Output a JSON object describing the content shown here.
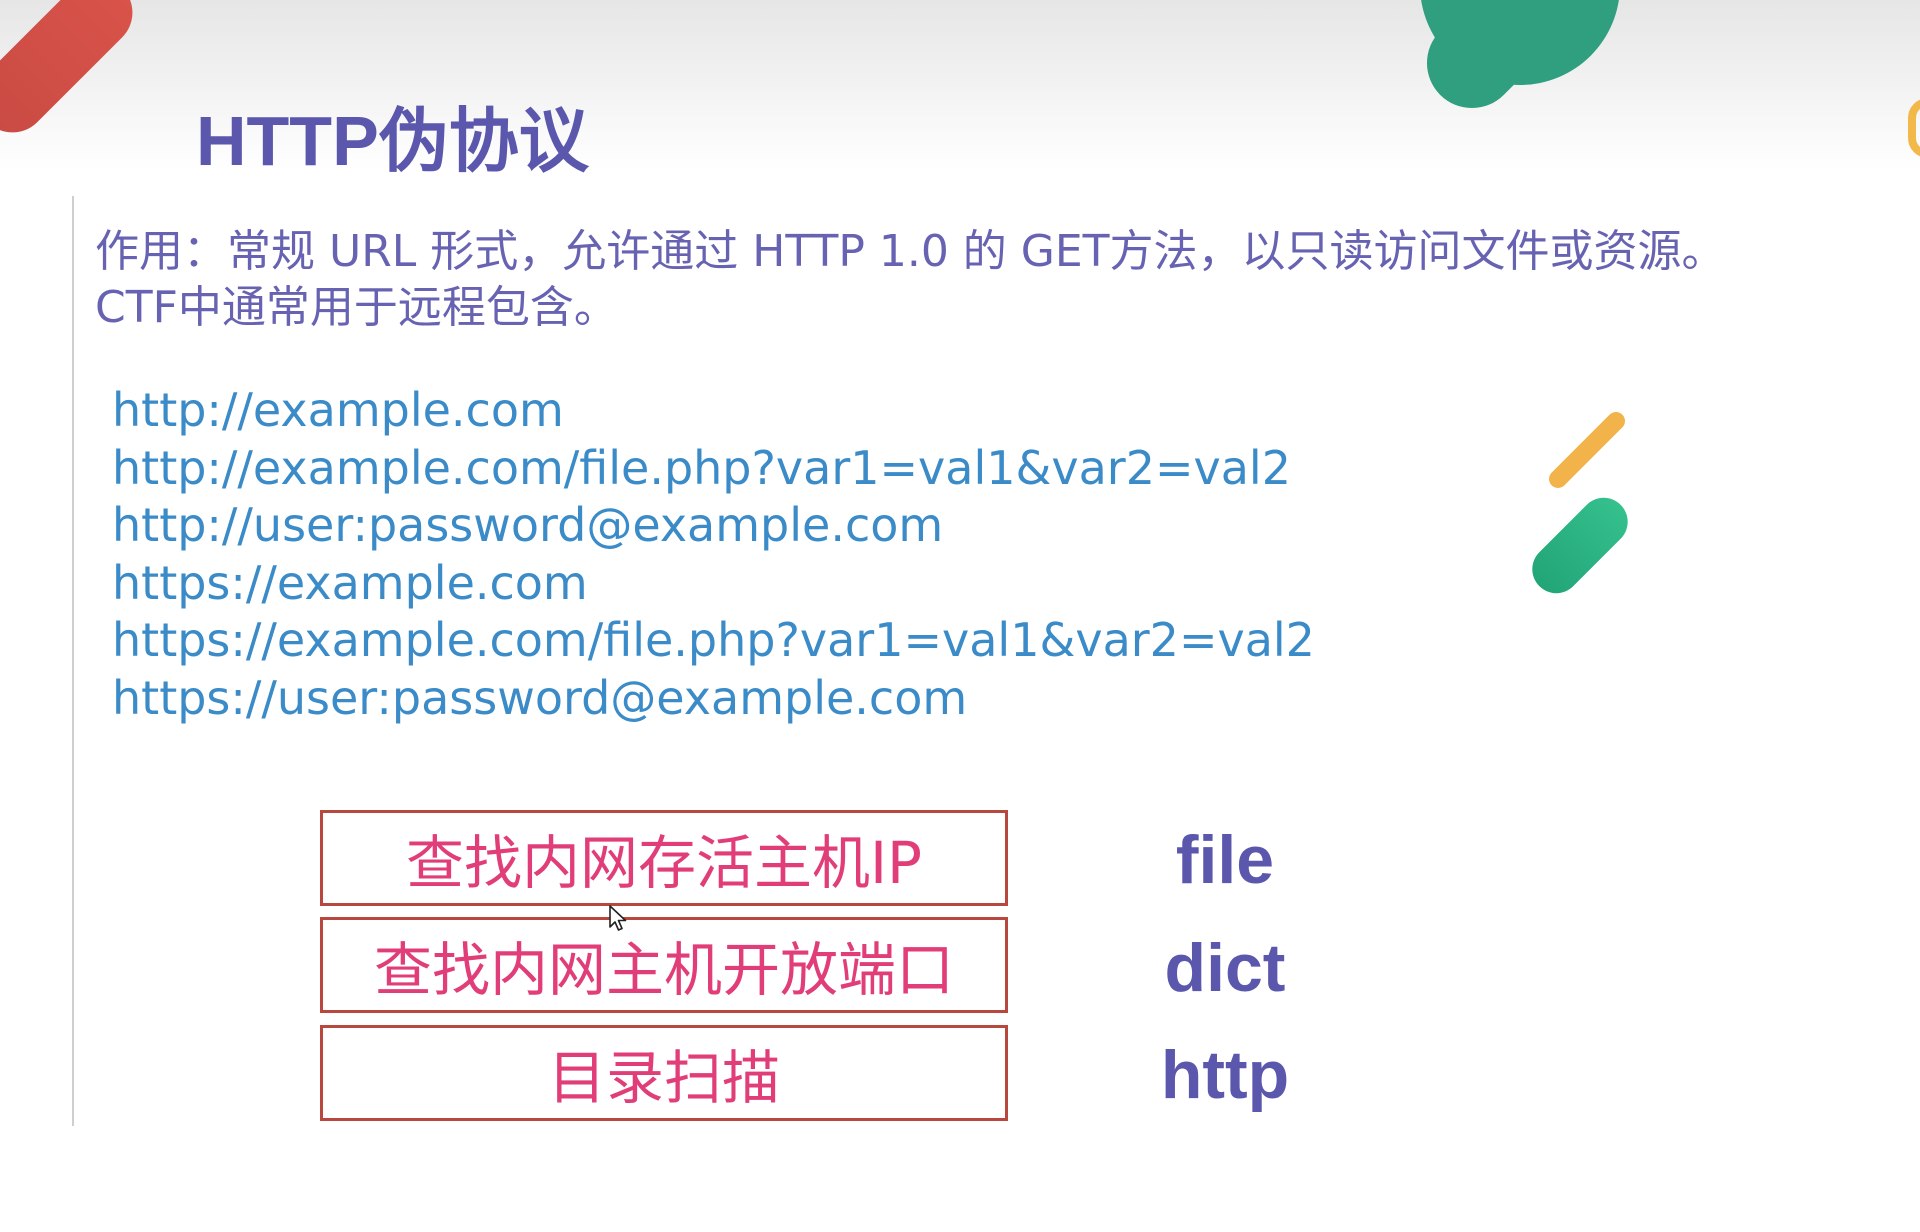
{
  "slide": {
    "title": "HTTP伪协议",
    "description": [
      "作用：常规 URL 形式，允许通过 HTTP 1.0 的 GET方法，以只读访问文件或资源。",
      "CTF中通常用于远程包含。"
    ],
    "urls": [
      "http://example.com",
      "http://example.com/file.php?var1=val1&var2=val2",
      "http://user:password@example.com",
      "https://example.com",
      "https://example.com/file.php?var1=val1&var2=val2",
      "https://user:password@example.com"
    ],
    "tasks": [
      {
        "label": "查找内网存活主机IP",
        "protocol": "file"
      },
      {
        "label": "查找内网主机开放端口",
        "protocol": "dict"
      },
      {
        "label": "目录扫描",
        "protocol": "http"
      }
    ]
  },
  "colors": {
    "title": "#5b57ad",
    "description": "#6763b2",
    "url": "#3a8bc8",
    "task_text": "#e13d78",
    "task_border": "#b8483e",
    "deco_red": "#d9534a",
    "deco_green": "#2f9f7f",
    "deco_yellow": "#f2b34a",
    "deco_green_light": "#35c08e"
  },
  "icons": {
    "cursor": "mouse-pointer-icon"
  }
}
